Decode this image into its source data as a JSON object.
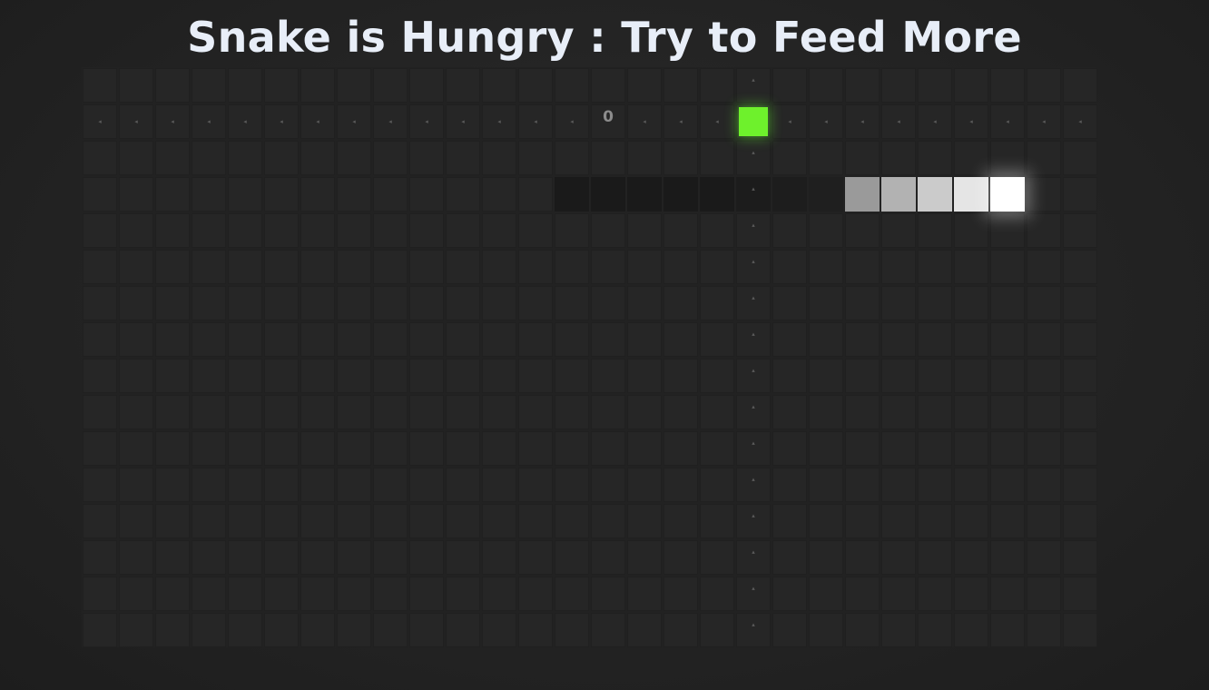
{
  "title": "Snake is Hungry : Try to Feed More",
  "score": "0",
  "colors": {
    "food": "#6ef12c",
    "snake_head": "#ffffff",
    "snake_body": [
      "#9a9a9a",
      "#b2b2b2",
      "#cbcbcb",
      "#e5e5e5",
      "#ffffff"
    ],
    "snake_trail": [
      "#1a1a1a",
      "#1a1a1a",
      "#1a1a1a",
      "#1a1a1a",
      "#1a1a1a",
      "#1c1c1c",
      "#1d1d1d",
      "#1f1f1f"
    ]
  },
  "grid": {
    "columns": 28,
    "rows": 16
  },
  "food": {
    "col": 18,
    "row": 1
  },
  "snake": {
    "head": {
      "col": 25,
      "row": 3
    },
    "direction": "right",
    "body": [
      {
        "col": 21,
        "row": 3
      },
      {
        "col": 22,
        "row": 3
      },
      {
        "col": 23,
        "row": 3
      },
      {
        "col": 24,
        "row": 3
      },
      {
        "col": 25,
        "row": 3
      }
    ],
    "trail": [
      {
        "col": 13,
        "row": 3
      },
      {
        "col": 14,
        "row": 3
      },
      {
        "col": 15,
        "row": 3
      },
      {
        "col": 16,
        "row": 3
      },
      {
        "col": 17,
        "row": 3
      },
      {
        "col": 18,
        "row": 3
      },
      {
        "col": 19,
        "row": 3
      },
      {
        "col": 20,
        "row": 3
      }
    ]
  },
  "score_cell": {
    "col": 14,
    "row": 1
  },
  "hints": {
    "row_hint_row": 1,
    "col_hint_col": 18,
    "row_glyph": "◂",
    "col_glyph": "▴"
  }
}
